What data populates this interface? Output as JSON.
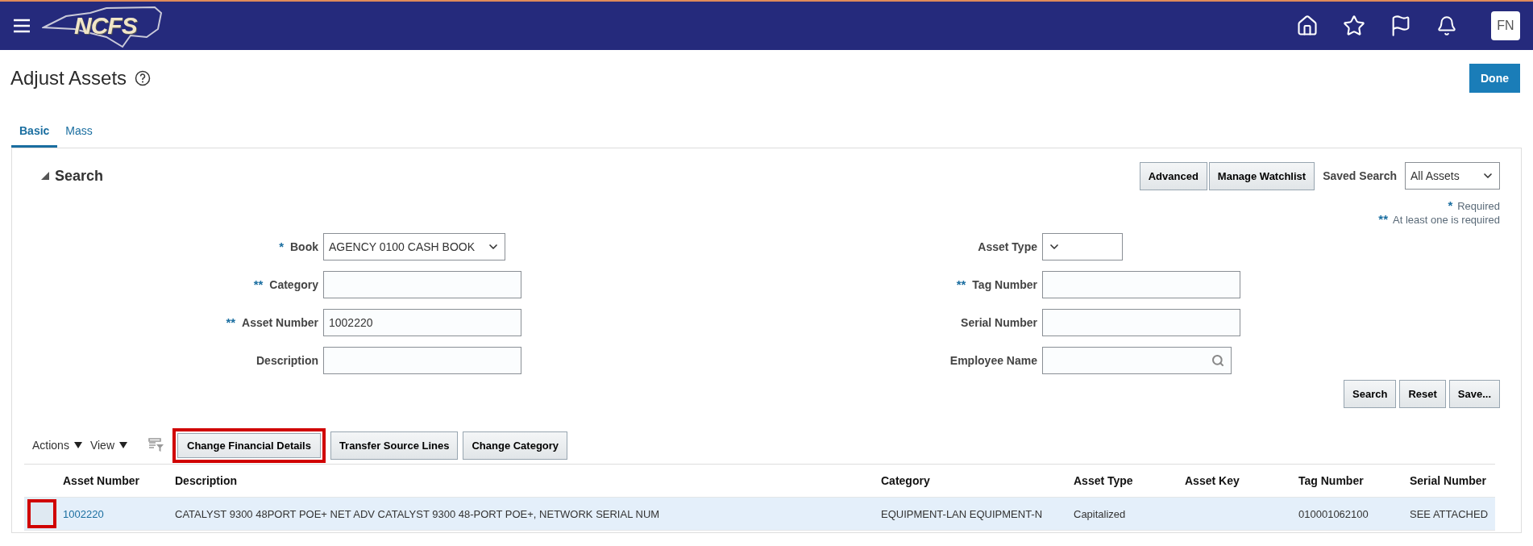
{
  "header": {
    "logo": "NCFS",
    "avatar": "FN"
  },
  "page": {
    "title": "Adjust Assets",
    "done_button": "Done"
  },
  "tabs": [
    {
      "label": "Basic",
      "selected": true
    },
    {
      "label": "Mass",
      "selected": false
    }
  ],
  "search": {
    "title": "Search",
    "expanded": true,
    "buttons": [
      "Advanced",
      "Manage Watchlist"
    ],
    "saved_search_label": "Saved Search",
    "saved_search_value": "All Assets",
    "notes": [
      {
        "mark": "*",
        "text": "Required"
      },
      {
        "mark": "**",
        "text": "At least one is required"
      }
    ],
    "left_fields": [
      {
        "mark": "*",
        "label": "Book",
        "kind": "select",
        "value": "AGENCY 0100 CASH BOOK"
      },
      {
        "mark": "**",
        "label": "Category",
        "kind": "text"
      },
      {
        "mark": "**",
        "label": "Asset Number",
        "kind": "text",
        "value": "1002220"
      },
      {
        "label": "Description",
        "kind": "text"
      }
    ],
    "right_fields": [
      {
        "label": "Asset Type",
        "kind": "select"
      },
      {
        "mark": "**",
        "label": "Tag Number",
        "kind": "text"
      },
      {
        "label": "Serial Number",
        "kind": "text"
      },
      {
        "label": "Employee Name",
        "kind": "lookup"
      }
    ],
    "actions": [
      "Search",
      "Reset",
      "Save..."
    ]
  },
  "results": {
    "menus": [
      "Actions",
      "View"
    ],
    "buttons": [
      {
        "label": "Change Financial Details",
        "highlighted": true
      },
      {
        "label": "Transfer Source Lines",
        "highlighted": false
      },
      {
        "label": "Change Category",
        "highlighted": false
      }
    ],
    "columns": [
      "Asset Number",
      "Description",
      "Category",
      "Asset Type",
      "Asset Key",
      "Tag Number",
      "Serial Number"
    ],
    "rows": [
      {
        "selected": true,
        "selector_highlighted": true,
        "cells": [
          "1002220",
          "CATALYST 9300 48PORT POE+ NET ADV CATALYST 9300 48-PORT POE+, NETWORK SERIAL NUM",
          "EQUIPMENT-LAN EQUIPMENT-N",
          "Capitalized",
          null,
          "010001062100",
          "SEE ATTACHED"
        ]
      }
    ]
  }
}
